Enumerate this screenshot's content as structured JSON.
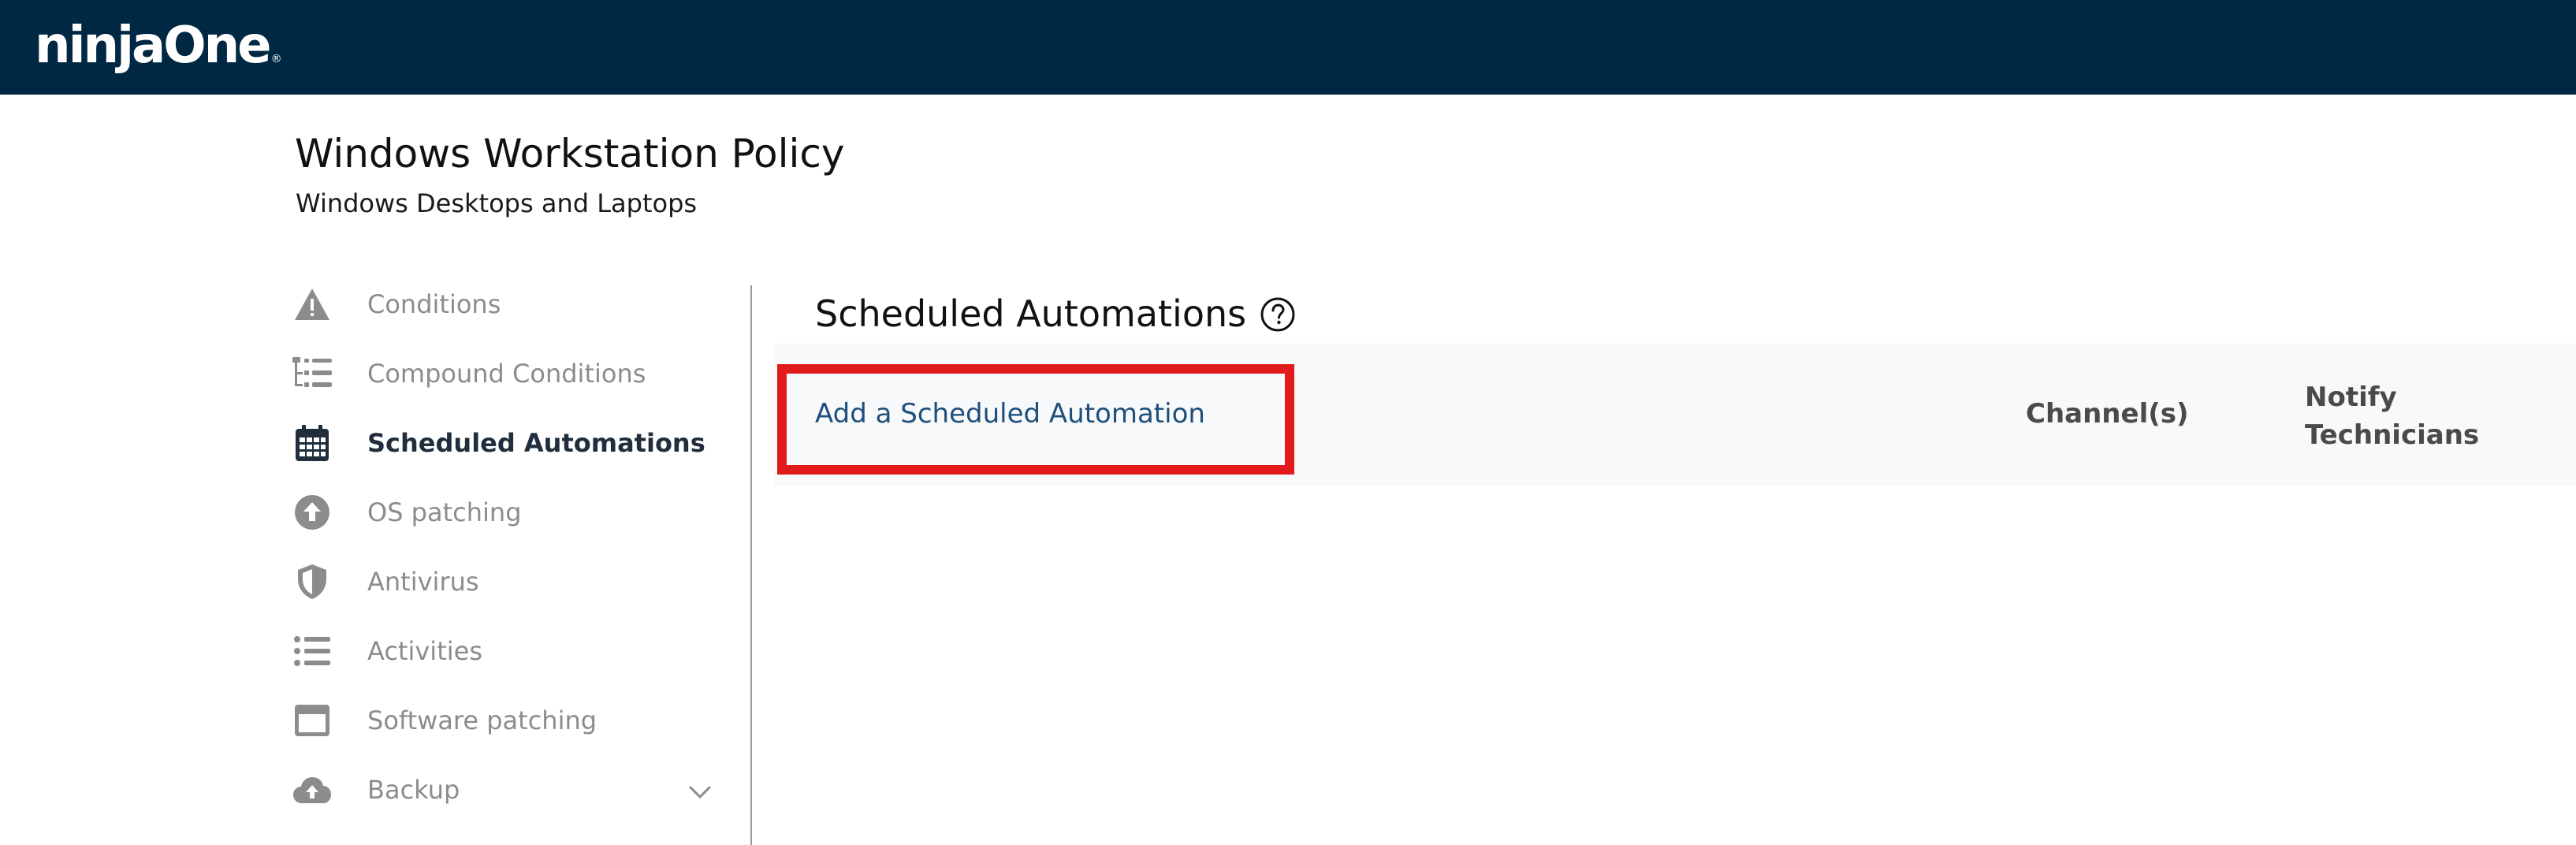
{
  "header": {
    "logo_text": "ninjaOne",
    "logo_mark": "®",
    "background_color": "#002842"
  },
  "policy": {
    "title": "Windows Workstation Policy",
    "subtitle": "Windows Desktops and Laptops"
  },
  "sidebar": {
    "items": [
      {
        "label": "Conditions",
        "icon": "warning-icon",
        "active": false
      },
      {
        "label": "Compound Conditions",
        "icon": "tree-list-icon",
        "active": false
      },
      {
        "label": "Scheduled Automations",
        "icon": "calendar-icon",
        "active": true
      },
      {
        "label": "OS patching",
        "icon": "upload-circle-icon",
        "active": false
      },
      {
        "label": "Antivirus",
        "icon": "shield-icon",
        "active": false
      },
      {
        "label": "Activities",
        "icon": "list-icon",
        "active": false
      },
      {
        "label": "Software patching",
        "icon": "window-icon",
        "active": false
      },
      {
        "label": "Backup",
        "icon": "cloud-upload-icon",
        "active": false,
        "expandable": true
      }
    ]
  },
  "main": {
    "section_title": "Scheduled Automations",
    "help_icon": "question-circle-icon",
    "add_link": "Add a Scheduled Automation",
    "columns": {
      "channels": "Channel(s)",
      "notify_line1": "Notify",
      "notify_line2": "Technicians"
    }
  },
  "colors": {
    "highlight": "#e11b1b",
    "link": "#1e4f7c",
    "muted": "#8c8c8c"
  }
}
